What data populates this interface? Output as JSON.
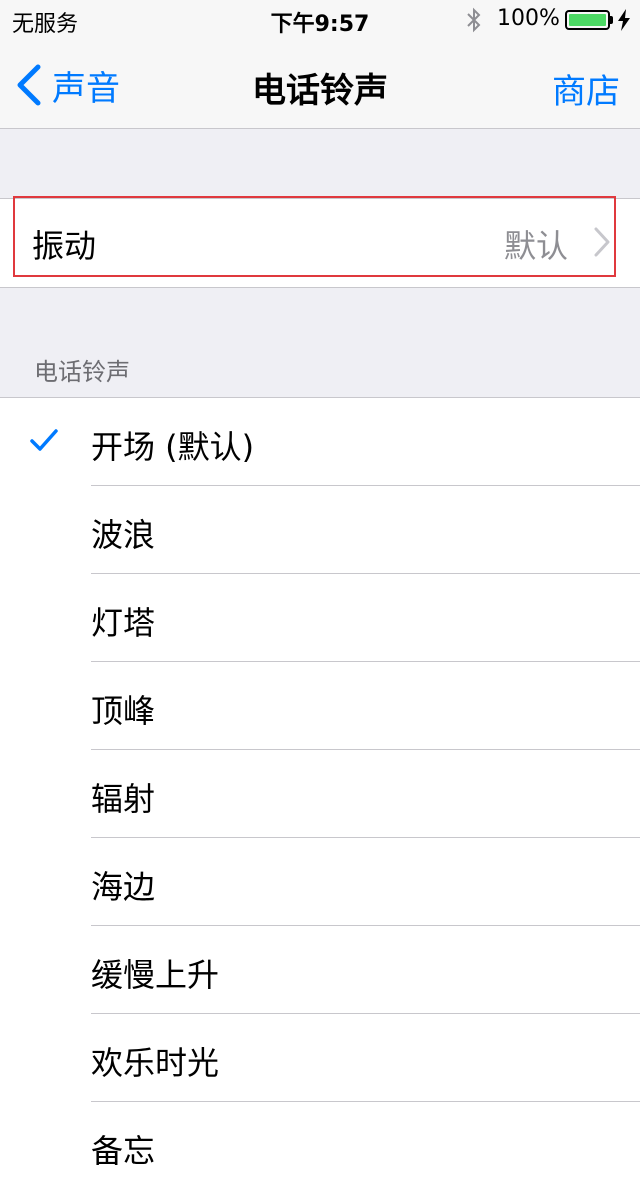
{
  "status_bar": {
    "carrier": "无服务",
    "time": "下午9:57",
    "battery_percent": "100%",
    "battery_level": 1.0,
    "icons": [
      "bluetooth-icon",
      "battery-icon",
      "charging-bolt-icon"
    ]
  },
  "nav": {
    "back_label": "声音",
    "title": "电话铃声",
    "right_label": "商店"
  },
  "vibration": {
    "label": "振动",
    "value": "默认"
  },
  "section_header": "电话铃声",
  "ringtones": [
    {
      "name": "开场 (默认)",
      "selected": true
    },
    {
      "name": "波浪",
      "selected": false
    },
    {
      "name": "灯塔",
      "selected": false
    },
    {
      "name": "顶峰",
      "selected": false
    },
    {
      "name": "辐射",
      "selected": false
    },
    {
      "name": "海边",
      "selected": false
    },
    {
      "name": "缓慢上升",
      "selected": false
    },
    {
      "name": "欢乐时光",
      "selected": false
    },
    {
      "name": "备忘",
      "selected": false
    }
  ],
  "colors": {
    "accent": "#007aff",
    "highlight_border": "#e0393e",
    "battery_fill": "#4cd964"
  }
}
